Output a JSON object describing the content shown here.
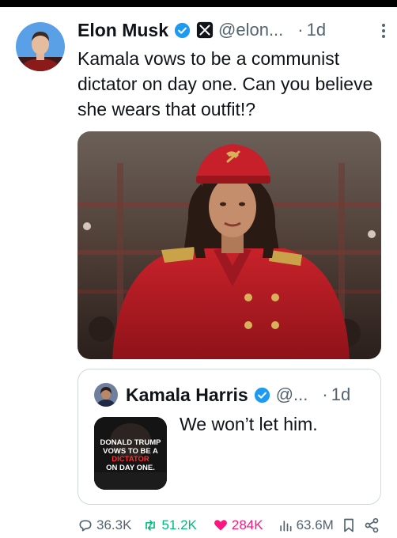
{
  "tweet": {
    "author_name": "Elon Musk",
    "handle": "@elon...",
    "separator": "·",
    "time": "1d",
    "text": "Kamala vows to be a communist dictator on day one. Can you believe she wears that outfit!?"
  },
  "quote": {
    "author_name": "Kamala Harris",
    "handle": "@...",
    "separator": "·",
    "time": "1d",
    "text": "We won’t let him.",
    "thumbnail_lines": [
      "DONALD TRUMP",
      "VOWS TO BE A",
      "DICTATOR",
      "ON DAY ONE."
    ]
  },
  "actions": {
    "replies": "36.3K",
    "reposts": "51.2K",
    "likes": "284K",
    "views": "63.6M"
  },
  "icons": {
    "verified": "verified-badge-icon",
    "x_logo": "x-logo-icon",
    "more": "more-vertical-icon",
    "reply": "reply-icon",
    "repost": "repost-icon",
    "like": "heart-icon",
    "views": "views-icon",
    "bookmark": "bookmark-icon",
    "share": "share-icon"
  },
  "colors": {
    "verified": "#1d9bf0",
    "repost": "#00ba7c",
    "like": "#f91880",
    "secondary_text": "#536471"
  }
}
